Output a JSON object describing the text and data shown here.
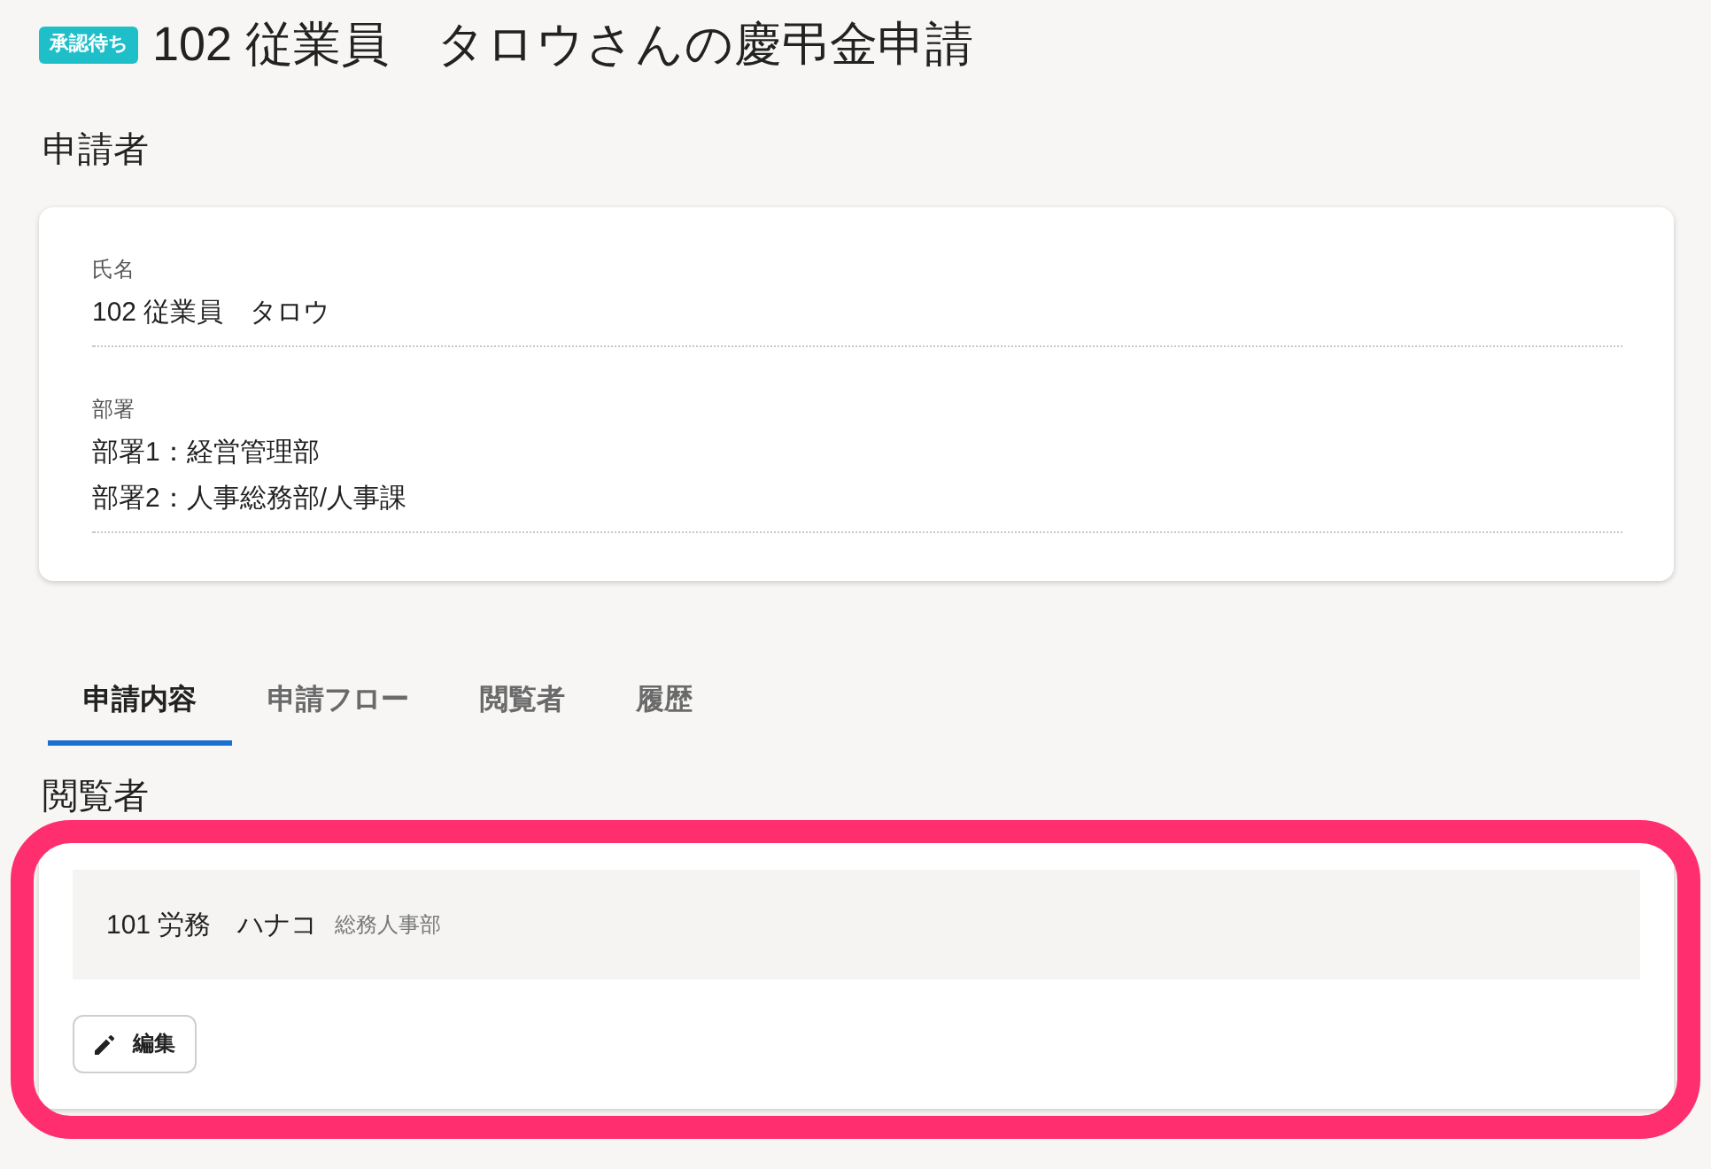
{
  "header": {
    "status_badge": "承認待ち",
    "title": "102 従業員　タロウさんの慶弔金申請"
  },
  "applicant": {
    "heading": "申請者",
    "fields": [
      {
        "label": "氏名",
        "values": [
          "102 従業員　タロウ"
        ]
      },
      {
        "label": "部署",
        "values": [
          "部署1：経営管理部",
          "部署2：人事総務部/人事課"
        ]
      }
    ]
  },
  "tabs": [
    {
      "label": "申請内容",
      "selected": true
    },
    {
      "label": "申請フロー",
      "selected": false
    },
    {
      "label": "閲覧者",
      "selected": false
    },
    {
      "label": "履歴",
      "selected": false
    }
  ],
  "viewers": {
    "heading": "閲覧者",
    "highlighted": true,
    "entries": [
      {
        "name": "101 労務　ハナコ",
        "department": "総務人事部"
      }
    ],
    "edit_button": "編集"
  }
}
